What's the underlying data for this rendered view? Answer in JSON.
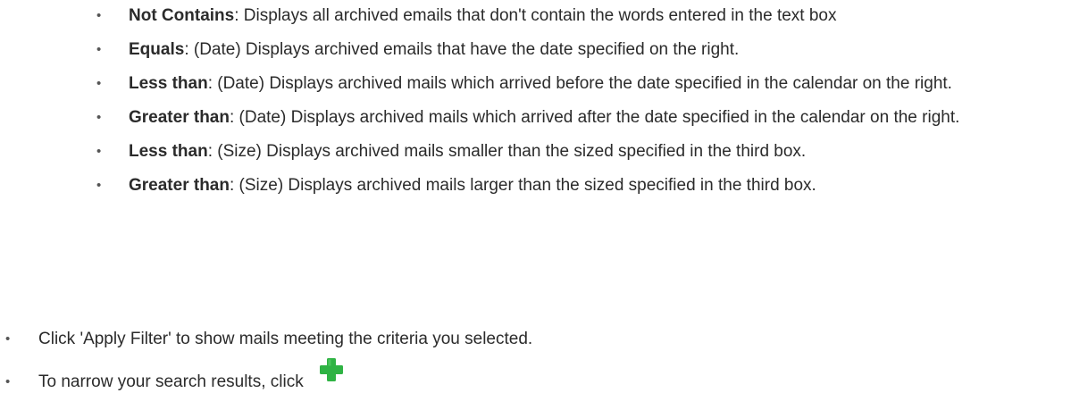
{
  "filter_options": [
    {
      "term": "Not Contains",
      "description": ": Displays all archived emails that don't contain the words entered in the text box"
    },
    {
      "term": "Equals",
      "description": ": (Date) Displays archived emails that have the date specified on the right."
    },
    {
      "term": "Less than",
      "description": ": (Date) Displays archived mails which arrived before the date specified in the calendar on the right."
    },
    {
      "term": "Greater than",
      "description": ": (Date) Displays archived mails which arrived after the date specified in the calendar on the right."
    },
    {
      "term": "Less than",
      "description": ": (Size) Displays archived mails smaller than the sized specified in the third box."
    },
    {
      "term": "Greater than",
      "description": ": (Size) Displays archived mails larger than the sized specified in the third box."
    }
  ],
  "steps": [
    {
      "text": "Click 'Apply Filter' to show mails meeting the criteria you selected."
    },
    {
      "text": "To narrow your search results, click"
    }
  ],
  "bullet_char": "•",
  "icons": {
    "add": "plus-icon"
  },
  "colors": {
    "text": "#2b2b2b",
    "plus_icon": "#2fb344"
  }
}
